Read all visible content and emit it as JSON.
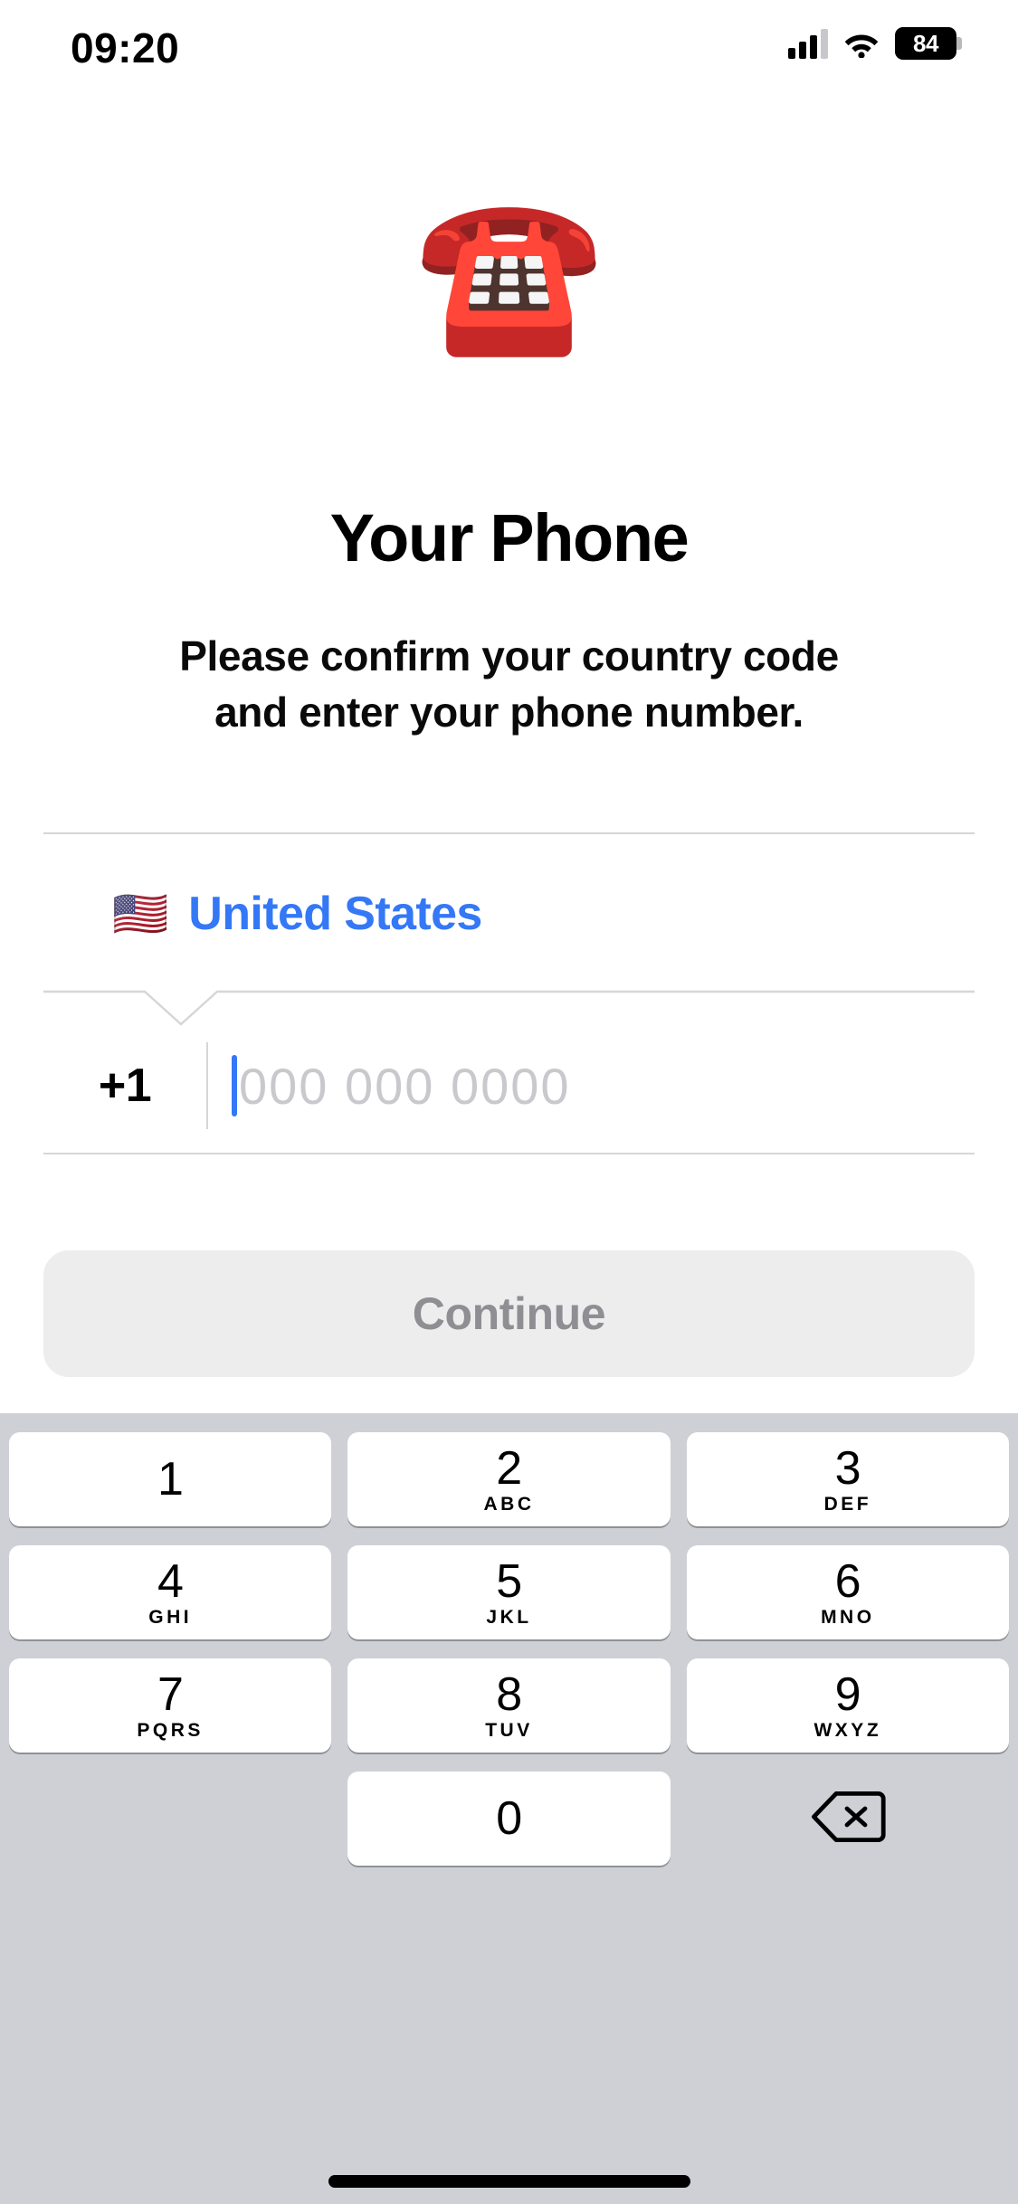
{
  "status_bar": {
    "time": "09:20",
    "battery_percent": "84",
    "signal_icon": "cellular-signal-icon",
    "wifi_icon": "wifi-icon",
    "battery_icon": "battery-icon"
  },
  "hero": {
    "emoji": "☎️",
    "emoji_name": "telephone-emoji",
    "title": "Your Phone",
    "subtitle_line1": "Please confirm your country code",
    "subtitle_line2": "and enter your phone number."
  },
  "form": {
    "country_flag": "🇺🇸",
    "country_name": "United States",
    "country_color": "#3478f6",
    "country_code": "+1",
    "phone_placeholder": "000 000 0000",
    "phone_value": "",
    "caret_color": "#3478f6"
  },
  "continue_button": {
    "label": "Continue",
    "enabled": false,
    "bg_color": "#ededed",
    "text_color": "#8e8e93"
  },
  "keypad": {
    "bg_color": "#ced0d6",
    "rows": [
      [
        {
          "digit": "1",
          "letters": ""
        },
        {
          "digit": "2",
          "letters": "ABC"
        },
        {
          "digit": "3",
          "letters": "DEF"
        }
      ],
      [
        {
          "digit": "4",
          "letters": "GHI"
        },
        {
          "digit": "5",
          "letters": "JKL"
        },
        {
          "digit": "6",
          "letters": "MNO"
        }
      ],
      [
        {
          "digit": "7",
          "letters": "PQRS"
        },
        {
          "digit": "8",
          "letters": "TUV"
        },
        {
          "digit": "9",
          "letters": "WXYZ"
        }
      ],
      [
        {
          "digit": "",
          "letters": "",
          "type": "blank"
        },
        {
          "digit": "0",
          "letters": ""
        },
        {
          "digit": "",
          "letters": "",
          "type": "delete",
          "icon": "backspace-icon"
        }
      ]
    ]
  }
}
